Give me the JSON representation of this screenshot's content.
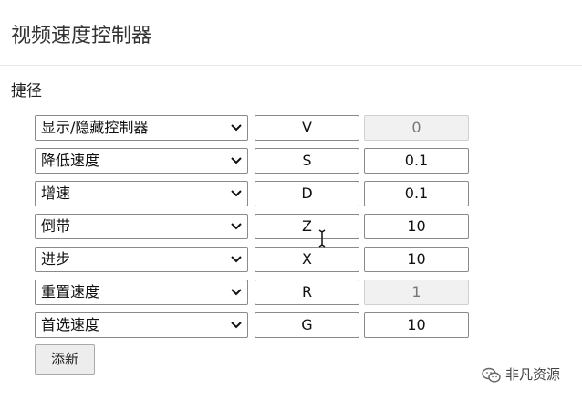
{
  "header": {
    "title": "视频速度控制器"
  },
  "shortcuts": {
    "section_title": "捷径",
    "rows": [
      {
        "action": "显示/隐藏控制器",
        "key": "V",
        "value": "0",
        "value_disabled": true
      },
      {
        "action": "降低速度",
        "key": "S",
        "value": "0.1",
        "value_disabled": false
      },
      {
        "action": "增速",
        "key": "D",
        "value": "0.1",
        "value_disabled": false
      },
      {
        "action": "倒带",
        "key": "Z",
        "value": "10",
        "value_disabled": false
      },
      {
        "action": "进步",
        "key": "X",
        "value": "10",
        "value_disabled": false
      },
      {
        "action": "重置速度",
        "key": "R",
        "value": "1",
        "value_disabled": true
      },
      {
        "action": "首选速度",
        "key": "G",
        "value": "10",
        "value_disabled": false
      }
    ],
    "add_label": "添新"
  },
  "watermark": {
    "text": "非凡资源",
    "icon": "wechat-icon"
  },
  "colors": {
    "border": "#8a8a8a",
    "disabled_bg": "#f1f1f1",
    "button_bg": "#ededed"
  }
}
